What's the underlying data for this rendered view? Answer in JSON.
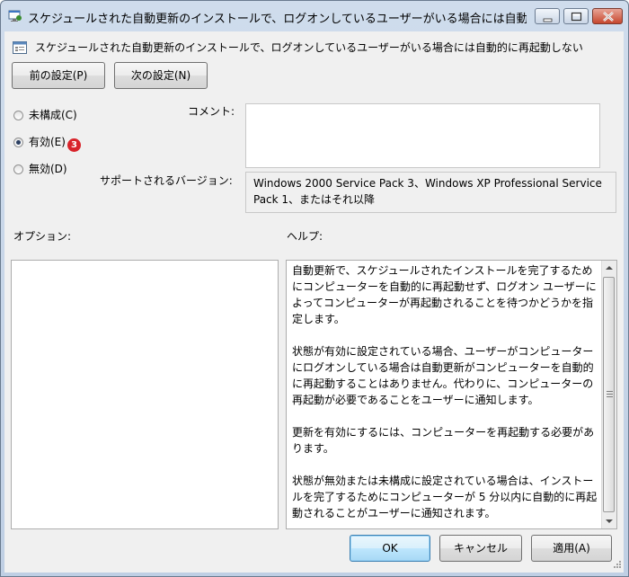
{
  "window": {
    "title": "スケジュールされた自動更新のインストールで、ログオンしているユーザーがいる場合には自動的に...",
    "icon": "policy-window-icon"
  },
  "header": {
    "text": "スケジュールされた自動更新のインストールで、ログオンしているユーザーがいる場合には自動的に再起動しない",
    "icon": "policy-setting-icon"
  },
  "nav": {
    "prev_label": "前の設定(P)",
    "next_label": "次の設定(N)"
  },
  "state": {
    "options": [
      {
        "label": "未構成(C)",
        "checked": false
      },
      {
        "label": "有効(E)",
        "checked": true,
        "badge": "3"
      },
      {
        "label": "無効(D)",
        "checked": false
      }
    ]
  },
  "comment": {
    "label": "コメント:",
    "value": ""
  },
  "supported": {
    "label": "サポートされるバージョン:",
    "line1": "Windows 2000 Service Pack 3、Windows XP Professional Service",
    "line2": "Pack 1、またはそれ以降"
  },
  "options_pane": {
    "label": "オプション:"
  },
  "help": {
    "label": "ヘルプ:",
    "paragraphs": [
      "自動更新で、スケジュールされたインストールを完了するためにコンピューターを自動的に再起動せず、ログオン ユーザーによってコンピューターが再起動されることを待つかどうかを指定します。",
      "状態が有効に設定されている場合、ユーザーがコンピューターにログオンしている場合は自動更新がコンピューターを自動的に再起動することはありません。代わりに、コンピューターの再起動が必要であることをユーザーに通知します。",
      "更新を有効にするには、コンピューターを再起動する必要があります。",
      "状態が無効または未構成に設定されている場合は、インストールを完了するためにコンピューターが 5 分以内に自動的に再起動されることがユーザーに通知されます。"
    ]
  },
  "footer": {
    "ok_label": "OK",
    "cancel_label": "キャンセル",
    "apply_label": "適用(A)"
  },
  "colors": {
    "badge": "#d8232a",
    "title_gradient_top": "#cfdcec",
    "client_bg": "#f0f0f0"
  }
}
